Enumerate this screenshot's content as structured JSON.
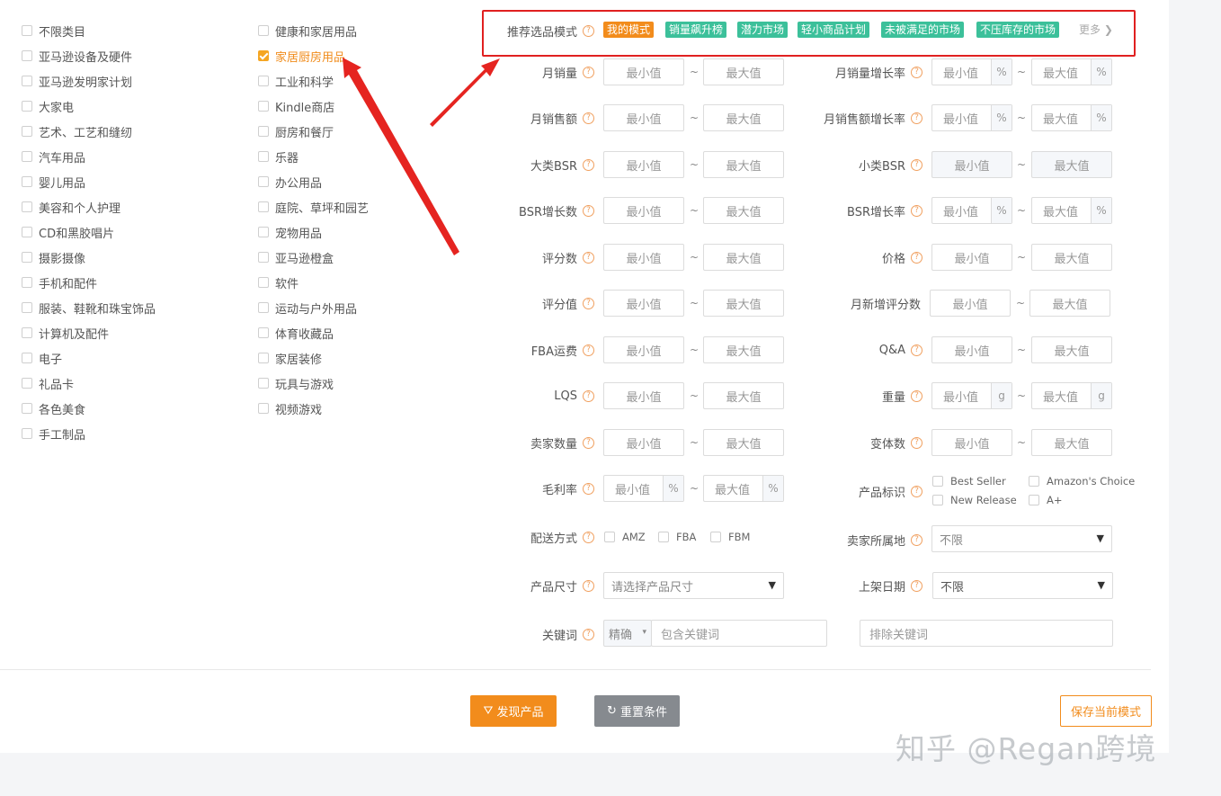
{
  "categories_col1": [
    "不限类目",
    "亚马逊设备及硬件",
    "亚马逊发明家计划",
    "大家电",
    "艺术、工艺和缝纫",
    "汽车用品",
    "婴儿用品",
    "美容和个人护理",
    "CD和黑胶唱片",
    "摄影摄像",
    "手机和配件",
    "服装、鞋靴和珠宝饰品",
    "计算机及配件",
    "电子",
    "礼品卡",
    "各色美食",
    "手工制品"
  ],
  "categories_col2": [
    "健康和家居用品",
    "家居厨房用品",
    "工业和科学",
    "Kindle商店",
    "厨房和餐厅",
    "乐器",
    "办公用品",
    "庭院、草坪和园艺",
    "宠物用品",
    "亚马逊橙盒",
    "软件",
    "运动与户外用品",
    "体育收藏品",
    "家居装修",
    "玩具与游戏",
    "视频游戏"
  ],
  "selected_category": "家居厨房用品",
  "mode": {
    "label": "推荐选品模式",
    "tags": [
      "我的模式",
      "销量飙升榜",
      "潜力市场",
      "轻小商品计划",
      "未被满足的市场",
      "不压库存的市场"
    ],
    "more": "更多",
    "colors": {
      "active": "#f28c1c",
      "tag": "#3cc09a"
    }
  },
  "placeholders": {
    "min": "最小值",
    "max": "最大值",
    "tilde": "~",
    "percent": "%",
    "gram": "g"
  },
  "filters_left": [
    "月销量",
    "月销售额",
    "大类BSR",
    "BSR增长数",
    "评分数",
    "评分值",
    "FBA运费",
    "LQS",
    "卖家数量",
    "毛利率"
  ],
  "filters_right": [
    "月销量增长率",
    "月销售额增长率",
    "小类BSR",
    "BSR增长率",
    "价格",
    "月新增评分数",
    "Q&A",
    "重量",
    "变体数"
  ],
  "product_flag": {
    "label": "产品标识",
    "options": [
      "Best Seller",
      "Amazon's Choice",
      "New Release",
      "A+"
    ]
  },
  "delivery": {
    "label": "配送方式",
    "options": [
      "AMZ",
      "FBA",
      "FBM"
    ]
  },
  "seller_location": {
    "label": "卖家所属地",
    "value": "不限"
  },
  "product_size": {
    "label": "产品尺寸",
    "placeholder": "请选择产品尺寸"
  },
  "listing_date": {
    "label": "上架日期",
    "value": "不限"
  },
  "keyword": {
    "label": "关键词",
    "match": "精确",
    "include_placeholder": "包含关键词",
    "exclude_placeholder": "排除关键词"
  },
  "buttons": {
    "discover": "发现产品",
    "reset": "重置条件",
    "save": "保存当前模式"
  },
  "watermark": "知乎 @Regan跨境"
}
